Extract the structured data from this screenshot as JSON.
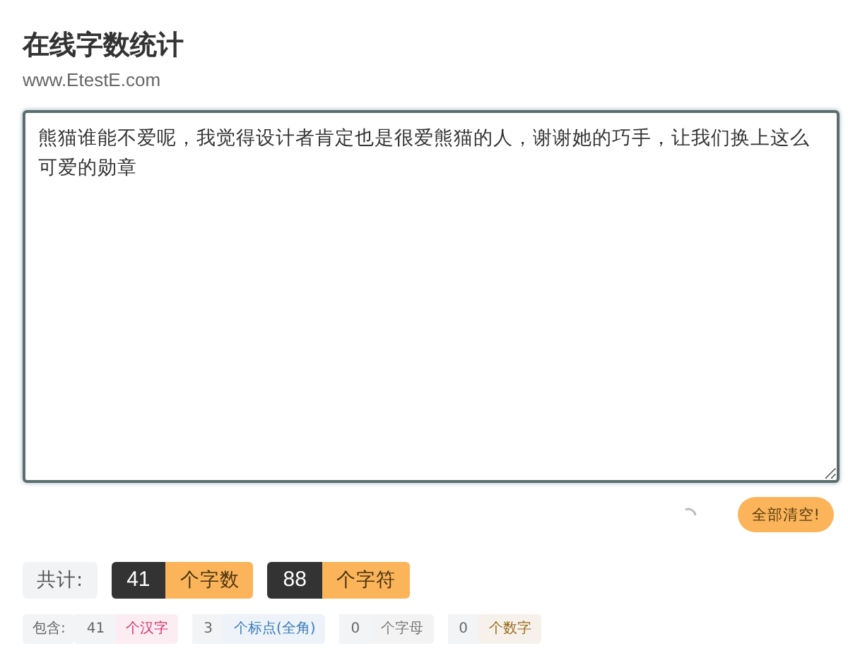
{
  "title": "在线字数统计",
  "site": "www.EtestE.com",
  "editor": {
    "value": "熊猫谁能不爱呢，我觉得设计者肯定也是很爱熊猫的人，谢谢她的巧手，让我们换上这么可爱的勋章"
  },
  "clear_button": "全部清空!",
  "totals": {
    "label": "共计:",
    "items": [
      {
        "count": "41",
        "unit": "个字数"
      },
      {
        "count": "88",
        "unit": "个字符"
      }
    ]
  },
  "details": {
    "label": "包含:",
    "items": [
      {
        "count": "41",
        "unit": "个汉字",
        "color": "#d6336c"
      },
      {
        "count": "3",
        "unit": "个标点(全角)",
        "color": "#3a7cb8"
      },
      {
        "count": "0",
        "unit": "个字母",
        "color": "#777777"
      },
      {
        "count": "0",
        "unit": "个数字",
        "color": "#9a6a1c"
      }
    ]
  }
}
